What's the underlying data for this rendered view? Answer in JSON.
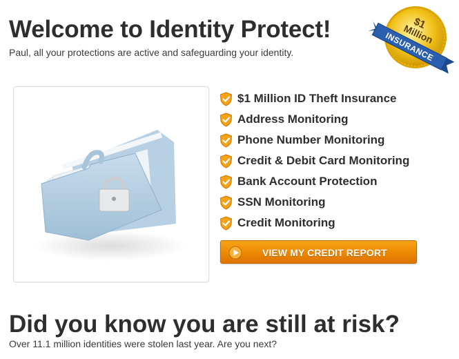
{
  "header": {
    "title": "Welcome to Identity Protect!",
    "subtitle": "Paul, all your protections are active and safeguarding your identity."
  },
  "badge": {
    "amount": "$1",
    "word": "Million",
    "ribbon": "INSURANCE",
    "icon": "insurance-seal-icon"
  },
  "image": {
    "icon": "locked-folder-icon"
  },
  "features": [
    {
      "label": "$1 Million ID Theft Insurance",
      "icon": "shield-check-icon"
    },
    {
      "label": "Address Monitoring",
      "icon": "shield-check-icon"
    },
    {
      "label": "Phone Number Monitoring",
      "icon": "shield-check-icon"
    },
    {
      "label": "Credit & Debit Card Monitoring",
      "icon": "shield-check-icon"
    },
    {
      "label": "Bank Account Protection",
      "icon": "shield-check-icon"
    },
    {
      "label": "SSN Monitoring",
      "icon": "shield-check-icon"
    },
    {
      "label": "Credit Monitoring",
      "icon": "shield-check-icon"
    }
  ],
  "cta": {
    "label": "VIEW MY CREDIT REPORT",
    "icon": "play-icon"
  },
  "risk": {
    "title": "Did you know you are still at risk?",
    "subtitle": "Over 11.1 million identities were stolen last year. Are you next?"
  },
  "colors": {
    "accent_orange": "#ee8b05",
    "gold": "#f2c21a",
    "ribbon_blue": "#2a5fb0",
    "text_dark": "#2e2e2e"
  }
}
